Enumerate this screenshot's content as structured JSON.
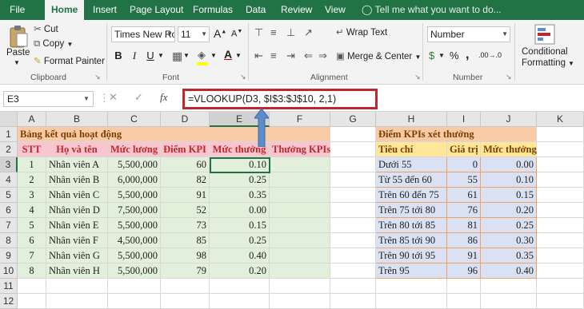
{
  "tabs": [
    "File",
    "Home",
    "Insert",
    "Page Layout",
    "Formulas",
    "Data",
    "Review",
    "View"
  ],
  "tell_me": "Tell me what you want to do...",
  "clipboard": {
    "paste": "Paste",
    "cut": "Cut",
    "copy": "Copy",
    "format_painter": "Format Painter",
    "label": "Clipboard"
  },
  "font": {
    "name": "Times New Ro",
    "size": "11",
    "bold": "B",
    "italic": "I",
    "underline": "U",
    "label": "Font"
  },
  "alignment": {
    "wrap_text": "Wrap Text",
    "merge_center": "Merge & Center",
    "label": "Alignment"
  },
  "number": {
    "format": "Number",
    "currency": "$",
    "percent": "%",
    "comma": ",",
    "inc_dec": ".00→.0",
    "label": "Number"
  },
  "styles": {
    "conditional_1": "Conditional",
    "conditional_2": "Formatting"
  },
  "formula_bar": {
    "name_box": "E3",
    "fx": "fx",
    "formula": "=VLOOKUP(D3, $I$3:$J$10, 2,1)"
  },
  "columns": [
    "A",
    "B",
    "C",
    "D",
    "E",
    "F",
    "G",
    "H",
    "I",
    "J",
    "K"
  ],
  "rows": [
    "1",
    "2",
    "3",
    "4",
    "5",
    "6",
    "7",
    "8",
    "9",
    "10",
    "11",
    "12"
  ],
  "table1": {
    "title": "Bảng kết quả hoạt động",
    "headers": [
      "STT",
      "Họ và tên",
      "Mức lương",
      "Điểm KPI",
      "Mức thưởng",
      "Thưởng KPIs"
    ],
    "rows": [
      [
        "1",
        "Nhân viên A",
        "5,500,000",
        "60",
        "0.10",
        ""
      ],
      [
        "2",
        "Nhân viên B",
        "6,000,000",
        "82",
        "0.25",
        ""
      ],
      [
        "3",
        "Nhân viên C",
        "5,500,000",
        "91",
        "0.35",
        ""
      ],
      [
        "4",
        "Nhân viên D",
        "7,500,000",
        "52",
        "0.00",
        ""
      ],
      [
        "5",
        "Nhân viên E",
        "5,500,000",
        "73",
        "0.15",
        ""
      ],
      [
        "6",
        "Nhân viên F",
        "4,500,000",
        "85",
        "0.25",
        ""
      ],
      [
        "7",
        "Nhân viên G",
        "5,500,000",
        "98",
        "0.40",
        ""
      ],
      [
        "8",
        "Nhân viên H",
        "5,500,000",
        "79",
        "0.20",
        ""
      ]
    ]
  },
  "table2": {
    "title": "Điểm KPIs xét thưởng",
    "headers": [
      "Tiêu chí",
      "Giá trị",
      "Mức thưởng"
    ],
    "rows": [
      [
        "Dưới 55",
        "0",
        "0.00"
      ],
      [
        "Từ 55 đến 60",
        "55",
        "0.10"
      ],
      [
        "Trên 60 đến 75",
        "61",
        "0.15"
      ],
      [
        "Trên 75 tới 80",
        "76",
        "0.20"
      ],
      [
        "Trên 80 tới 85",
        "81",
        "0.25"
      ],
      [
        "Trên 85 tới 90",
        "86",
        "0.30"
      ],
      [
        "Trên 90 tới 95",
        "91",
        "0.35"
      ],
      [
        "Trên 95",
        "96",
        "0.40"
      ]
    ]
  },
  "colors": {
    "excel_green": "#217346",
    "title_bg": "#f8cba6",
    "header1_bg": "#f9c6d0",
    "data1_bg": "#e2efda",
    "header2_bg": "#ffe699",
    "data2_bg": "#d9e1f2",
    "red": "#c0262c",
    "arrow": "#5b8ec9"
  }
}
